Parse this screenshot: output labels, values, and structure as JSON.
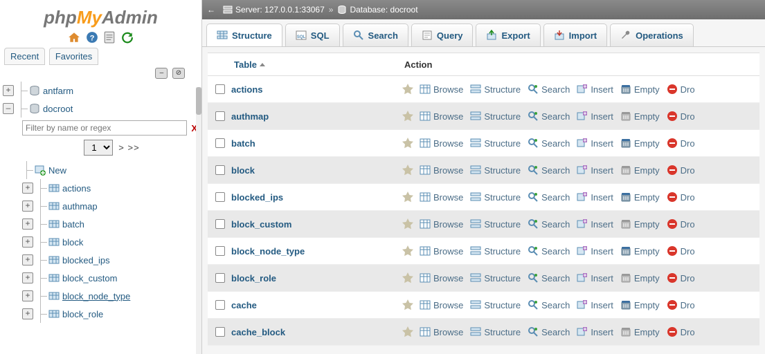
{
  "logo": {
    "p": "php",
    "m": "My",
    "a": "Admin"
  },
  "sidetabs": {
    "recent": "Recent",
    "fav": "Favorites"
  },
  "breadcrumb": {
    "server_lbl": "Server:",
    "server": "127.0.0.1:33067",
    "sep": "»",
    "db_lbl": "Database:",
    "db": "docroot"
  },
  "toptabs": {
    "structure": "Structure",
    "sql": "SQL",
    "search": "Search",
    "query": "Query",
    "export": "Export",
    "import": "Import",
    "operations": "Operations"
  },
  "tree": {
    "db1": "antfarm",
    "db2": "docroot",
    "filter_placeholder": "Filter by name or regex",
    "page_next": "> >>",
    "new": "New",
    "tables": [
      "actions",
      "authmap",
      "batch",
      "block",
      "blocked_ips",
      "block_custom",
      "block_node_type",
      "block_role"
    ]
  },
  "table": {
    "col_table": "Table",
    "col_action": "Action",
    "actions": {
      "browse": "Browse",
      "structure": "Structure",
      "search": "Search",
      "insert": "Insert",
      "empty": "Empty",
      "drop": "Dro"
    },
    "rows": [
      "actions",
      "authmap",
      "batch",
      "block",
      "blocked_ips",
      "block_custom",
      "block_node_type",
      "block_role",
      "cache",
      "cache_block"
    ]
  }
}
